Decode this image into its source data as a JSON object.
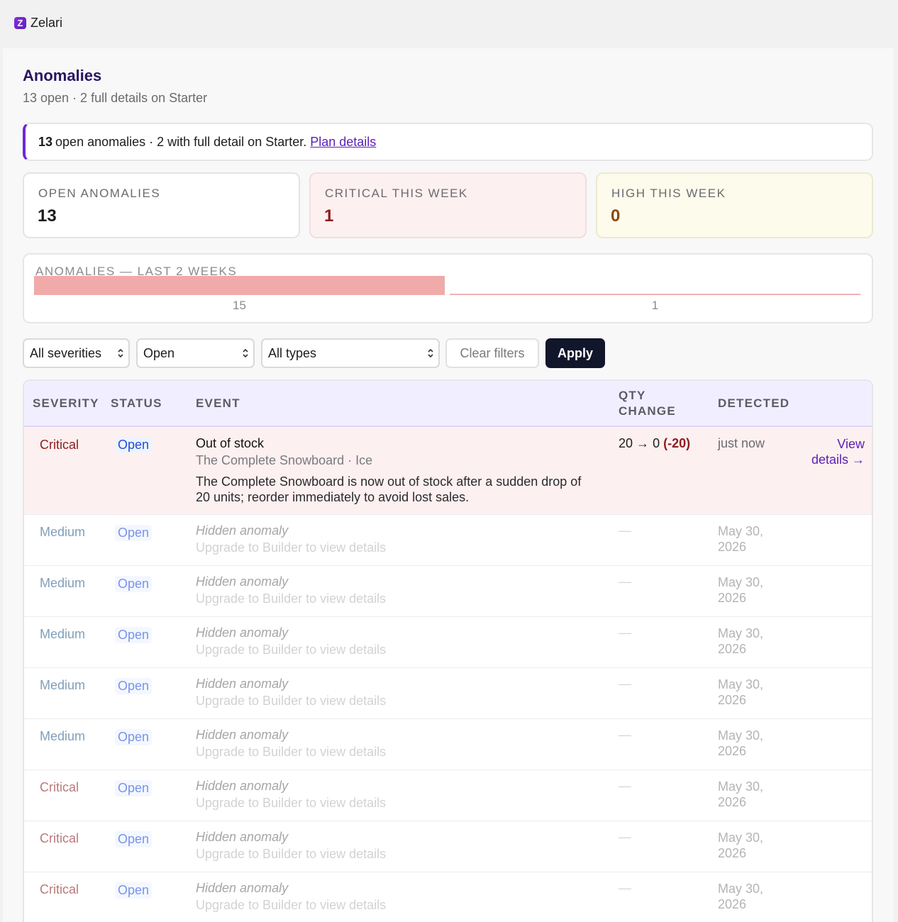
{
  "app": {
    "logo_letter": "Z",
    "name": "Zelari"
  },
  "page": {
    "title": "Anomalies",
    "subtitle": "13 open · 2 full details on Starter"
  },
  "banner": {
    "count": "13",
    "text": "open anomalies · 2 with full detail on Starter.",
    "link": "Plan details"
  },
  "stats": [
    {
      "label": "OPEN ANOMALIES",
      "value": "13"
    },
    {
      "label": "CRITICAL THIS WEEK",
      "value": "1"
    },
    {
      "label": "HIGH THIS WEEK",
      "value": "0"
    }
  ],
  "chart_data": {
    "type": "bar",
    "title": "ANOMALIES — LAST 2 WEEKS",
    "categories": [
      "",
      ""
    ],
    "values": [
      15,
      1
    ],
    "value_labels": [
      "15",
      "1"
    ],
    "bar_color": "#f0aaaa",
    "line_color": "#f0aaaa"
  },
  "filters": {
    "severity": "All severities",
    "status": "Open",
    "type": "All types",
    "clear_label": "Clear filters",
    "apply_label": "Apply"
  },
  "table": {
    "headers": {
      "severity": "SEVERITY",
      "status": "STATUS",
      "event": "EVENT",
      "qty_1": "QTY",
      "qty_2": "CHANGE",
      "detected": "DETECTED"
    },
    "first_row": {
      "severity": "Critical",
      "status": "Open",
      "title": "Out of stock",
      "product": "The Complete Snowboard · Ice",
      "description": "The Complete Snowboard is now out of stock after a sudden drop of 20 units; reorder immediately to avoid lost sales.",
      "qty_from": "20",
      "qty_arrow": "→",
      "qty_to": "0",
      "qty_delta": "(-20)",
      "detected": "just now",
      "action": "View details →"
    },
    "hidden_rows": [
      {
        "severity": "Medium",
        "status": "Open",
        "title": "Hidden anomaly",
        "sub": "Upgrade to Builder to view details",
        "qty": "—",
        "date_1": "May 30,",
        "date_2": "2026"
      },
      {
        "severity": "Medium",
        "status": "Open",
        "title": "Hidden anomaly",
        "sub": "Upgrade to Builder to view details",
        "qty": "—",
        "date_1": "May 30,",
        "date_2": "2026"
      },
      {
        "severity": "Medium",
        "status": "Open",
        "title": "Hidden anomaly",
        "sub": "Upgrade to Builder to view details",
        "qty": "—",
        "date_1": "May 30,",
        "date_2": "2026"
      },
      {
        "severity": "Medium",
        "status": "Open",
        "title": "Hidden anomaly",
        "sub": "Upgrade to Builder to view details",
        "qty": "—",
        "date_1": "May 30,",
        "date_2": "2026"
      },
      {
        "severity": "Medium",
        "status": "Open",
        "title": "Hidden anomaly",
        "sub": "Upgrade to Builder to view details",
        "qty": "—",
        "date_1": "May 30,",
        "date_2": "2026"
      },
      {
        "severity": "Critical",
        "status": "Open",
        "title": "Hidden anomaly",
        "sub": "Upgrade to Builder to view details",
        "qty": "—",
        "date_1": "May 30,",
        "date_2": "2026"
      },
      {
        "severity": "Critical",
        "status": "Open",
        "title": "Hidden anomaly",
        "sub": "Upgrade to Builder to view details",
        "qty": "—",
        "date_1": "May 30,",
        "date_2": "2026"
      },
      {
        "severity": "Critical",
        "status": "Open",
        "title": "Hidden anomaly",
        "sub": "Upgrade to Builder to view details",
        "qty": "—",
        "date_1": "May 30,",
        "date_2": "2026"
      }
    ]
  }
}
